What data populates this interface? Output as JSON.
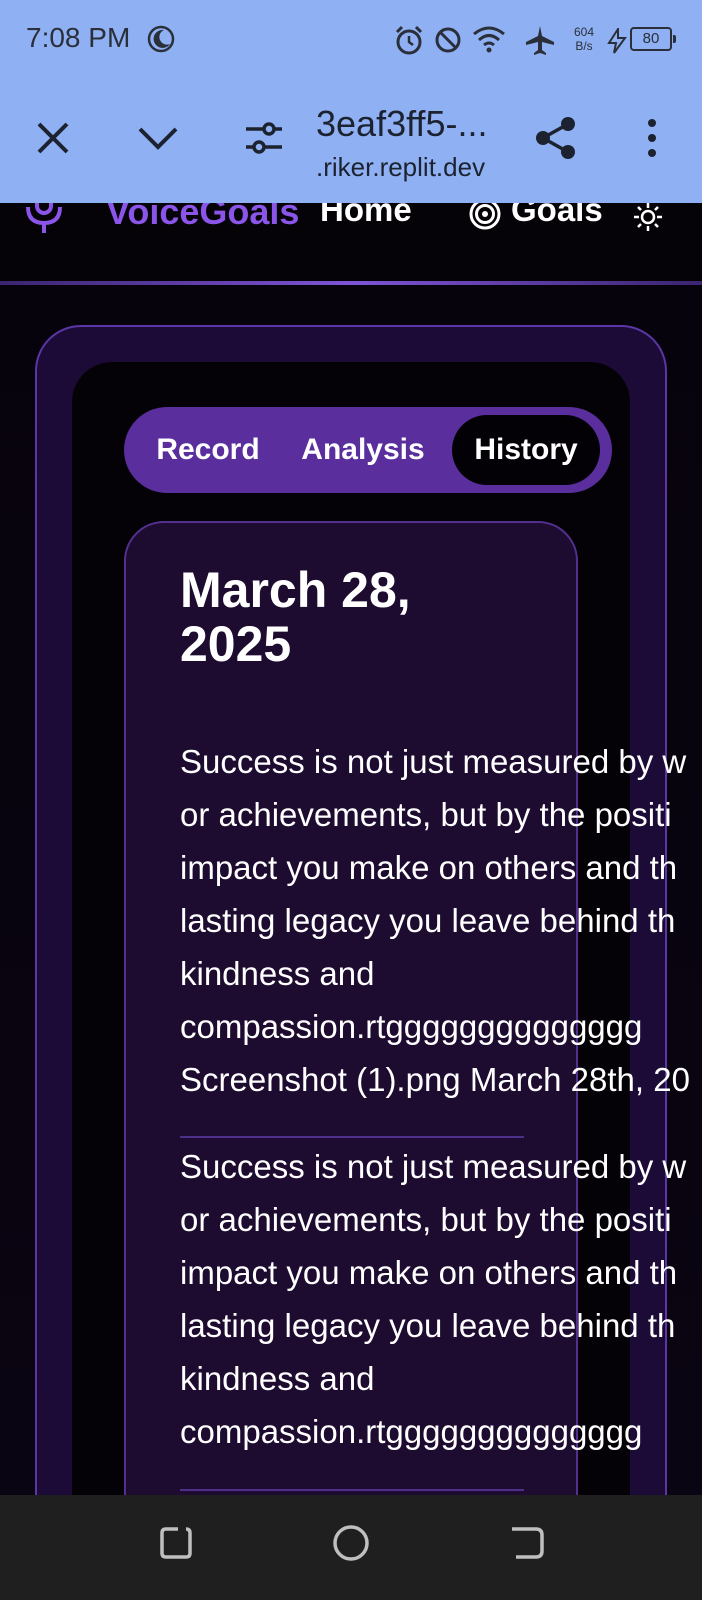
{
  "status_bar": {
    "time": "7:08 PM",
    "net_speed_value": "604",
    "net_speed_unit": "B/s",
    "battery": "80",
    "icons": [
      "moon-icon",
      "alarm-icon",
      "do-not-disturb-icon",
      "wifi-icon",
      "airplane-icon",
      "charging-icon",
      "battery-icon"
    ]
  },
  "browser": {
    "title": "3eaf3ff5-...",
    "url": ".riker.replit.dev",
    "icons": [
      "close-icon",
      "chevron-down-icon",
      "site-settings-icon",
      "share-icon",
      "more-icon"
    ]
  },
  "header": {
    "brand": "VoiceGoals",
    "nav_home": "Home",
    "nav_goals": "Goals",
    "icons": [
      "microphone-icon",
      "target-icon",
      "sun-icon"
    ],
    "accent": "#8a55e8"
  },
  "tabs": [
    {
      "label": "Record",
      "active": false
    },
    {
      "label": "Analysis",
      "active": false
    },
    {
      "label": "History",
      "active": true
    }
  ],
  "history": {
    "date_line1": "March 28,",
    "date_line2": "2025",
    "entries": [
      {
        "lines": [
          "Success is not just measured by w",
          "or achievements, but by the positi",
          "impact you make on others and th",
          "lasting legacy you leave behind th",
          "kindness and",
          "compassion.rtgggggggggggggg",
          "Screenshot (1).png March 28th, 20"
        ]
      },
      {
        "lines": [
          "Success is not just measured by w",
          "or achievements, but by the positi",
          "impact you make on others and th",
          "lasting legacy you leave behind th",
          "kindness and",
          "compassion.rtgggggggggggggg"
        ]
      }
    ]
  },
  "system_nav": {
    "icons": [
      "recents-icon",
      "home-icon",
      "back-icon"
    ]
  }
}
